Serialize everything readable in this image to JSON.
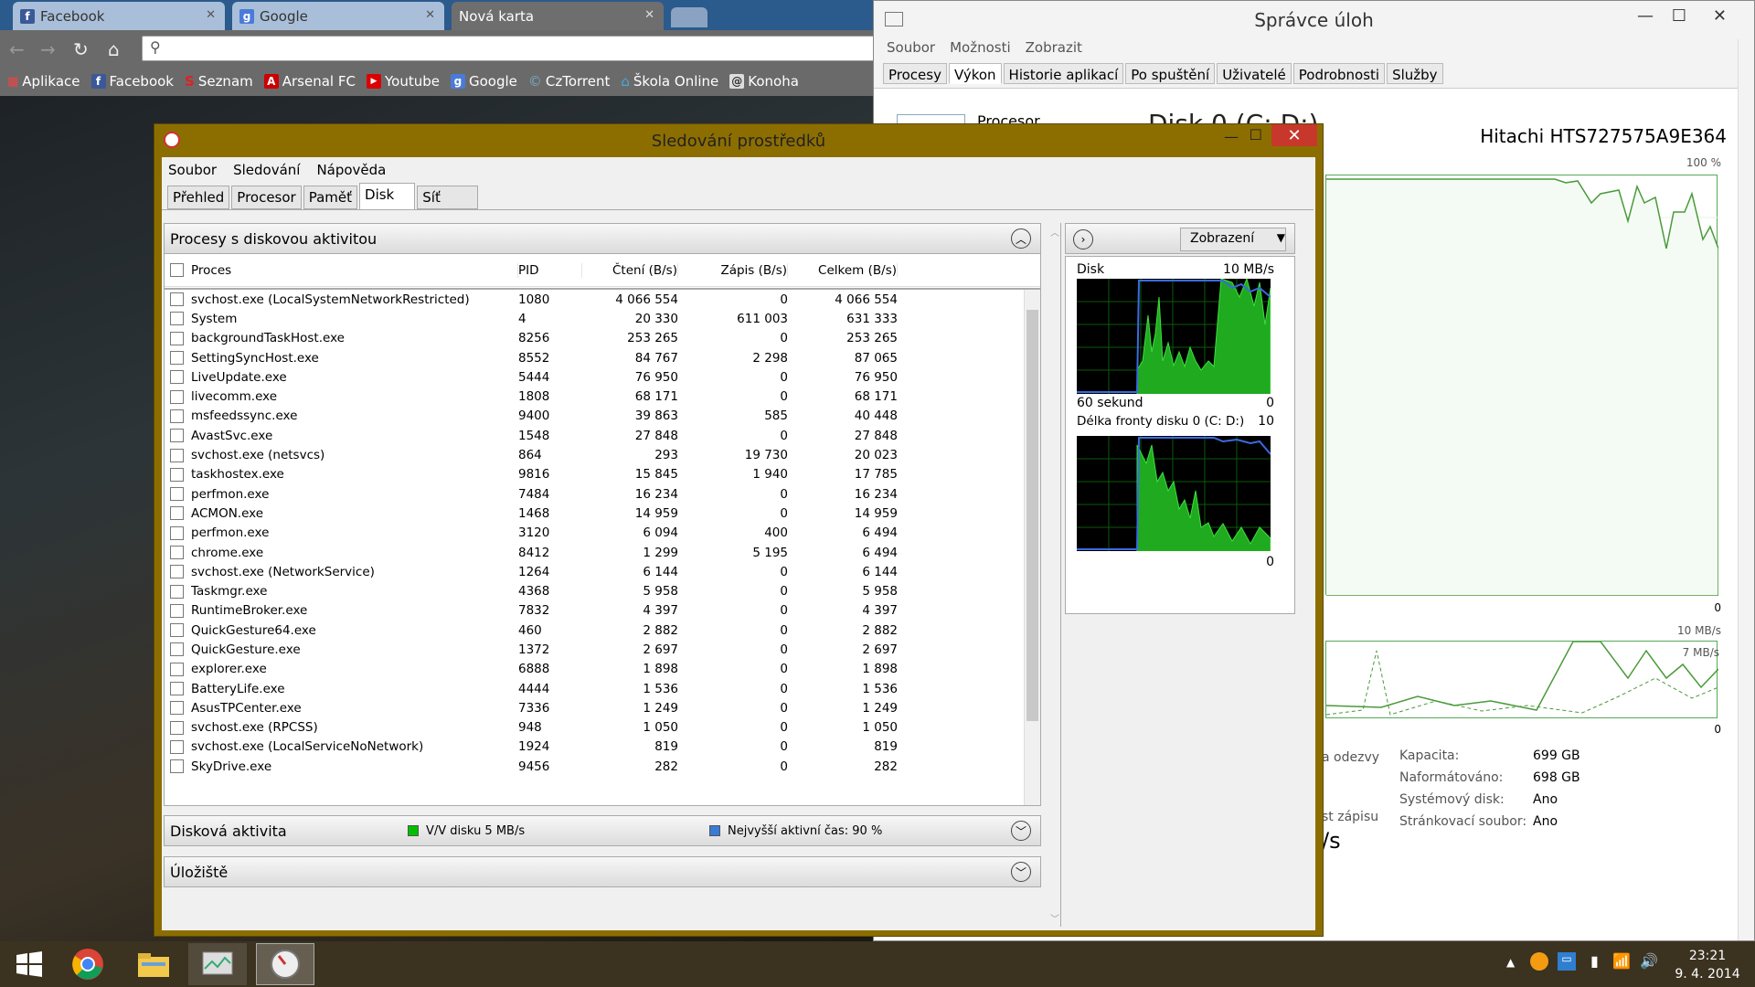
{
  "browser": {
    "tabs": [
      {
        "label": "Facebook",
        "icon": "facebook-icon",
        "active": false
      },
      {
        "label": "Google",
        "icon": "google-icon",
        "active": false
      },
      {
        "label": "Nová karta",
        "icon": "",
        "active": true
      }
    ],
    "bookmarks": [
      "Aplikace",
      "Facebook",
      "Seznam",
      "Arsenal FC",
      "Youtube",
      "Google",
      "CzTorrent",
      "Škola Online",
      "Konoha"
    ]
  },
  "task_manager": {
    "title": "Správce úloh",
    "menu": [
      "Soubor",
      "Možnosti",
      "Zobrazit"
    ],
    "tabs": [
      "Procesy",
      "Výkon",
      "Historie aplikací",
      "Po spuštění",
      "Uživatelé",
      "Podrobnosti",
      "Služby"
    ],
    "selected_tab": "Výkon",
    "partial_left_label": "Procesor",
    "disk_title": "Disk 0 (C: D:)",
    "disk_model": "Hitachi HTS727575A9E364",
    "graph1_max": "100 %",
    "graph1_min": "0",
    "graph2_max": "10 MB/s",
    "graph2_sub": "7 MB/s",
    "graph2_min": "0",
    "partial_odezvy": "a odezvy",
    "partial_zapisu": "st zápisu",
    "partial_speed": "/s",
    "stats": [
      {
        "label": "Kapacita:",
        "value": "699 GB"
      },
      {
        "label": "Naformátováno:",
        "value": "698 GB"
      },
      {
        "label": "Systémový disk:",
        "value": "Ano"
      },
      {
        "label": "Stránkovací soubor:",
        "value": "Ano"
      }
    ]
  },
  "resource_monitor": {
    "title": "Sledování prostředků",
    "menu": [
      "Soubor",
      "Sledování",
      "Nápověda"
    ],
    "tabs": [
      "Přehled",
      "Procesor",
      "Paměť",
      "Disk",
      "Síť"
    ],
    "selected_tab": "Disk",
    "processes_section": "Procesy s diskovou aktivitou",
    "columns": [
      "Proces",
      "PID",
      "Čtení (B/s)",
      "Zápis (B/s)",
      "Celkem (B/s)"
    ],
    "rows": [
      [
        "svchost.exe (LocalSystemNetworkRestricted)",
        "1080",
        "4 066 554",
        "0",
        "4 066 554"
      ],
      [
        "System",
        "4",
        "20 330",
        "611 003",
        "631 333"
      ],
      [
        "backgroundTaskHost.exe",
        "8256",
        "253 265",
        "0",
        "253 265"
      ],
      [
        "SettingSyncHost.exe",
        "8552",
        "84 767",
        "2 298",
        "87 065"
      ],
      [
        "LiveUpdate.exe",
        "5444",
        "76 950",
        "0",
        "76 950"
      ],
      [
        "livecomm.exe",
        "1808",
        "68 171",
        "0",
        "68 171"
      ],
      [
        "msfeedssync.exe",
        "9400",
        "39 863",
        "585",
        "40 448"
      ],
      [
        "AvastSvc.exe",
        "1548",
        "27 848",
        "0",
        "27 848"
      ],
      [
        "svchost.exe (netsvcs)",
        "864",
        "293",
        "19 730",
        "20 023"
      ],
      [
        "taskhostex.exe",
        "9816",
        "15 845",
        "1 940",
        "17 785"
      ],
      [
        "perfmon.exe",
        "7484",
        "16 234",
        "0",
        "16 234"
      ],
      [
        "ACMON.exe",
        "1468",
        "14 959",
        "0",
        "14 959"
      ],
      [
        "perfmon.exe",
        "3120",
        "6 094",
        "400",
        "6 494"
      ],
      [
        "chrome.exe",
        "8412",
        "1 299",
        "5 195",
        "6 494"
      ],
      [
        "svchost.exe (NetworkService)",
        "1264",
        "6 144",
        "0",
        "6 144"
      ],
      [
        "Taskmgr.exe",
        "4368",
        "5 958",
        "0",
        "5 958"
      ],
      [
        "RuntimeBroker.exe",
        "7832",
        "4 397",
        "0",
        "4 397"
      ],
      [
        "QuickGesture64.exe",
        "460",
        "2 882",
        "0",
        "2 882"
      ],
      [
        "QuickGesture.exe",
        "1372",
        "2 697",
        "0",
        "2 697"
      ],
      [
        "explorer.exe",
        "6888",
        "1 898",
        "0",
        "1 898"
      ],
      [
        "BatteryLife.exe",
        "4444",
        "1 536",
        "0",
        "1 536"
      ],
      [
        "AsusTPCenter.exe",
        "7336",
        "1 249",
        "0",
        "1 249"
      ],
      [
        "svchost.exe (RPCSS)",
        "948",
        "1 050",
        "0",
        "1 050"
      ],
      [
        "svchost.exe (LocalServiceNoNetwork)",
        "1924",
        "819",
        "0",
        "819"
      ],
      [
        "SkyDrive.exe",
        "9456",
        "282",
        "0",
        "282"
      ]
    ],
    "disk_activity_section": "Disková aktivita",
    "legend_io": "V/V disku 5 MB/s",
    "legend_active": "Nejvyšší aktivní čas: 90 %",
    "legend_io_color": "#00c000",
    "legend_active_color": "#3a7bd5",
    "storage_section": "Úložiště",
    "view_button": "Zobrazení",
    "graph_disk_label": "Disk",
    "graph_disk_max": "10 MB/s",
    "graph_disk_time": "60 sekund",
    "graph_disk_min": "0",
    "graph_queue_label": "Délka fronty disku 0 (C: D:)",
    "graph_queue_max": "10",
    "graph_queue_min": "0"
  },
  "taskbar": {
    "apps": [
      "windows-start-icon",
      "chrome-icon",
      "file-explorer-icon",
      "task-manager-icon",
      "resource-monitor-icon"
    ],
    "time": "23:21",
    "date": "9. 4. 2014"
  }
}
